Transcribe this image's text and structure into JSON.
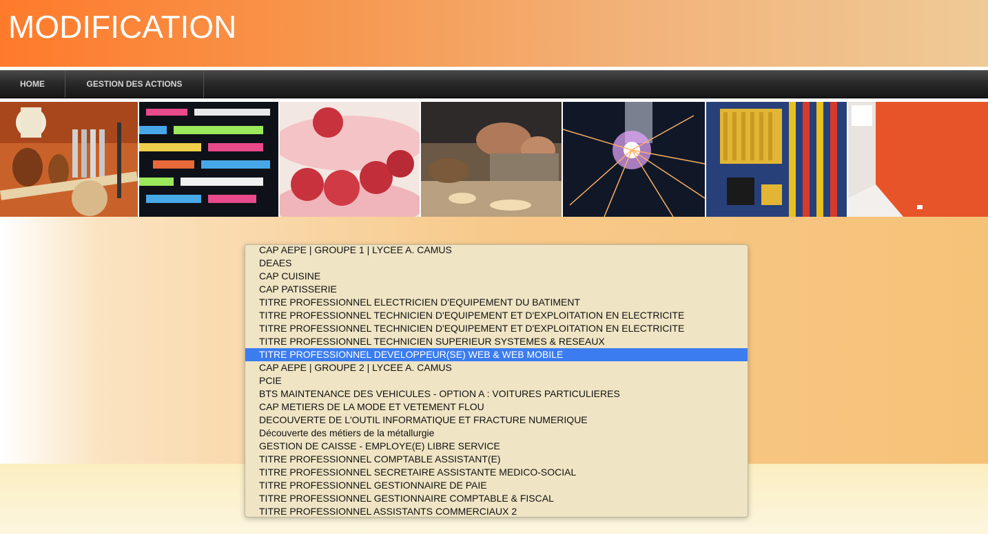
{
  "header": {
    "title": "MODIFICATION"
  },
  "nav": {
    "items": [
      {
        "label": "HOME"
      },
      {
        "label": "GESTION DES ACTIONS"
      }
    ]
  },
  "banner": {
    "images": [
      {
        "icon": "leather-tools-image"
      },
      {
        "icon": "code-screen-image"
      },
      {
        "icon": "raspberry-macaron-image"
      },
      {
        "icon": "woodworking-plane-image"
      },
      {
        "icon": "laser-cutting-image"
      },
      {
        "icon": "motherboard-image"
      },
      {
        "icon": "painted-room-image"
      }
    ]
  },
  "dropdown": {
    "selected_index": 8,
    "options": [
      "CAP AEPE | GROUPE 1 | LYCEE A. CAMUS",
      "DEAES",
      "CAP CUISINE",
      "CAP PATISSERIE",
      "TITRE PROFESSIONNEL ELECTRICIEN D'EQUIPEMENT DU BATIMENT",
      "TITRE PROFESSIONNEL TECHNICIEN D'EQUIPEMENT ET D'EXPLOITATION EN ELECTRICITE",
      "TITRE PROFESSIONNEL TECHNICIEN D'EQUIPEMENT ET D'EXPLOITATION EN ELECTRICITE",
      "TITRE PROFESSIONNEL TECHNICIEN SUPERIEUR SYSTEMES & RESEAUX",
      "TITRE PROFESSIONNEL DEVELOPPEUR(SE) WEB & WEB MOBILE",
      "CAP AEPE | GROUPE 2 | LYCEE A. CAMUS",
      "PCIE",
      "BTS MAINTENANCE DES VEHICULES - OPTION A : VOITURES PARTICULIERES",
      "CAP METIERS DE LA MODE ET VETEMENT FLOU",
      "DECOUVERTE DE L'OUTIL INFORMATIQUE ET FRACTURE NUMERIQUE",
      "Découverte des métiers de la métallurgie",
      "GESTION DE CAISSE - EMPLOYE(E) LIBRE SERVICE",
      "TITRE PROFESSIONNEL COMPTABLE ASSISTANT(E)",
      "TITRE PROFESSIONNEL SECRETAIRE ASSISTANTE MEDICO-SOCIAL",
      "TITRE PROFESSIONNEL GESTIONNAIRE DE PAIE",
      "TITRE PROFESSIONNEL GESTIONNAIRE COMPTABLE & FISCAL",
      "TITRE PROFESSIONNEL ASSISTANTS COMMERCIAUX 2"
    ]
  },
  "colors": {
    "header_orange": "#ff7a2b",
    "selection_blue": "#3b7cf0",
    "nav_dark": "#1e1e1e"
  }
}
